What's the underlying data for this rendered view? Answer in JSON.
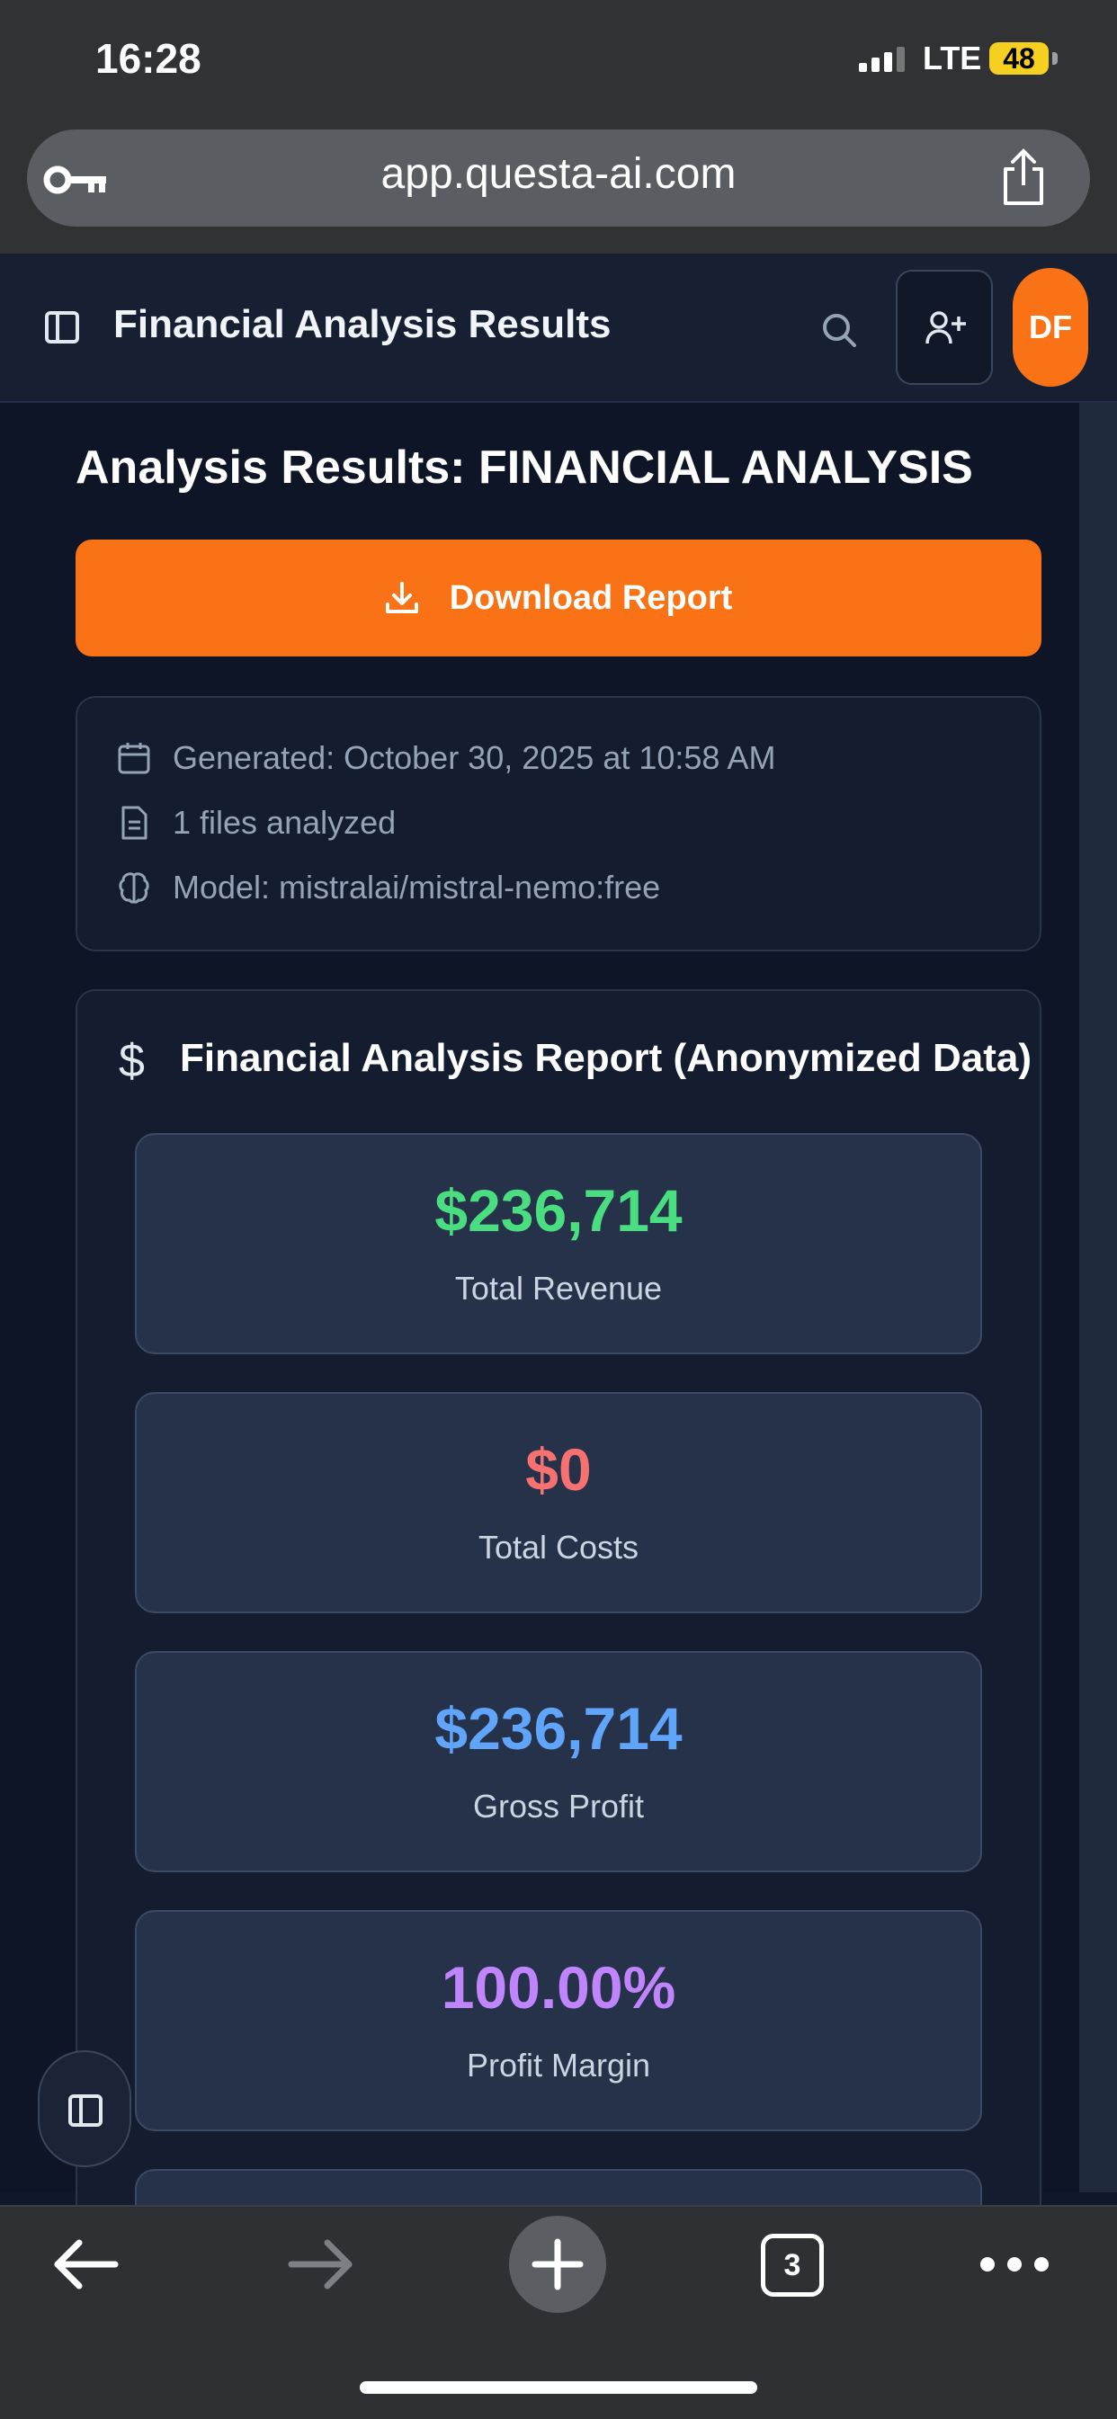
{
  "status_bar": {
    "time": "16:28",
    "network": "LTE",
    "battery": "48"
  },
  "browser": {
    "url": "app.questa-ai.com",
    "open_tabs": "3"
  },
  "header": {
    "title": "Financial Analysis Results",
    "avatar_initials": "DF",
    "icons": [
      "sidebar-toggle-icon",
      "search-icon",
      "add-user-icon"
    ]
  },
  "main": {
    "heading": "Analysis Results: FINANCIAL ANALYSIS",
    "download_label": "Download Report",
    "meta": {
      "generated": "Generated: October 30, 2025 at 10:58 AM",
      "files": "1 files analyzed",
      "model": "Model: mistralai/mistral-nemo:free"
    },
    "report": {
      "title": "Financial Analysis Report (Anonymized Data)",
      "stats": [
        {
          "value": "$236,714",
          "label": "Total Revenue",
          "color": "#4ade80"
        },
        {
          "value": "$0",
          "label": "Total Costs",
          "color": "#f87171"
        },
        {
          "value": "$236,714",
          "label": "Gross Profit",
          "color": "#60a5fa"
        },
        {
          "value": "100.00%",
          "label": "Profit Margin",
          "color": "#c084fc"
        }
      ]
    }
  },
  "colors": {
    "accent": "#f97316",
    "background": "#0d1526"
  }
}
